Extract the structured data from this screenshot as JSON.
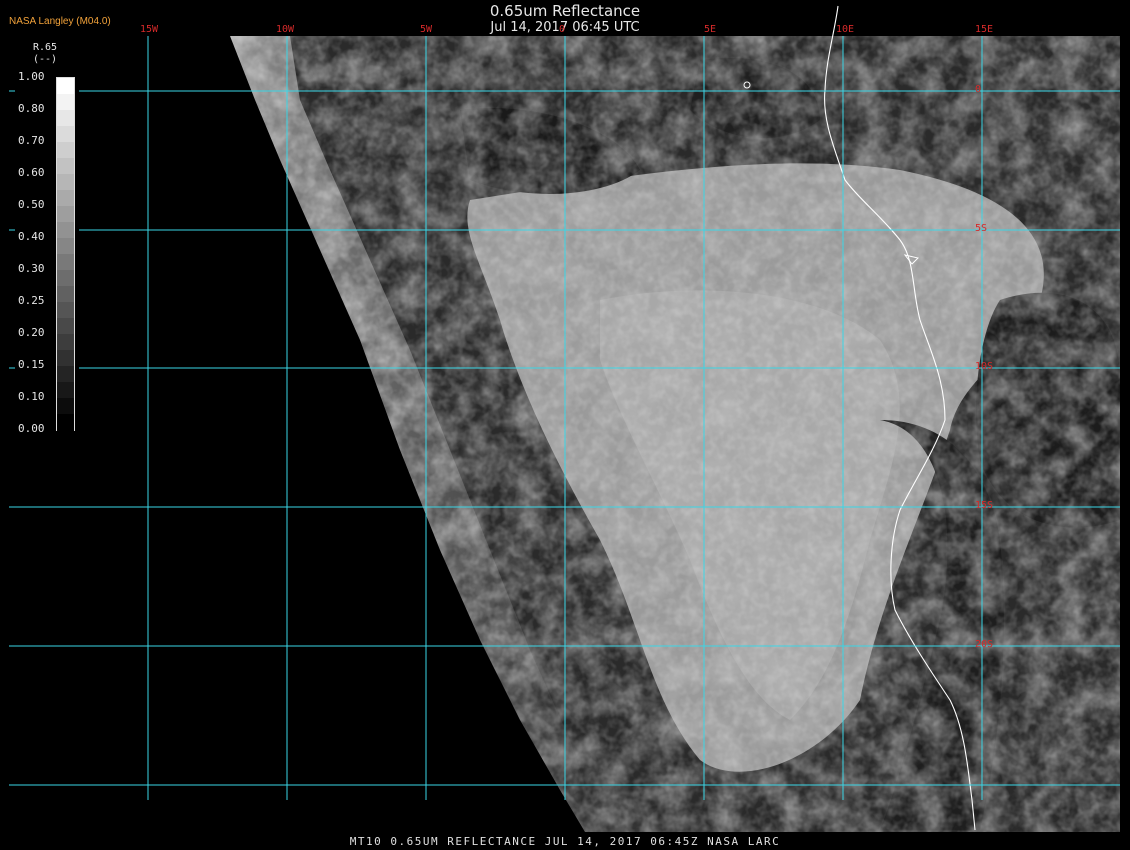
{
  "header": {
    "title": "0.65um Reflectance",
    "subtitle": "Jul 14, 2017 06:45 UTC",
    "brand": "NASA Langley (M04.0)"
  },
  "grid": {
    "longitude_labels": [
      "15W",
      "10W",
      "5W",
      "0",
      "5E",
      "10E",
      "15E"
    ],
    "latitude_labels": [
      "0",
      "5S",
      "10S",
      "15S",
      "20S"
    ],
    "grid_color": "#3ad6e6",
    "label_color": "#d62a2a"
  },
  "legend": {
    "title": "R.65",
    "units": "(--)",
    "ticks": [
      "1.00",
      "0.80",
      "0.70",
      "0.60",
      "0.50",
      "0.40",
      "0.30",
      "0.25",
      "0.20",
      "0.15",
      "0.10",
      "0.00"
    ]
  },
  "footer": {
    "text": "MT10  0.65UM REFLECTANCE   JUL 14, 2017 06:45Z   NASA LARC"
  }
}
